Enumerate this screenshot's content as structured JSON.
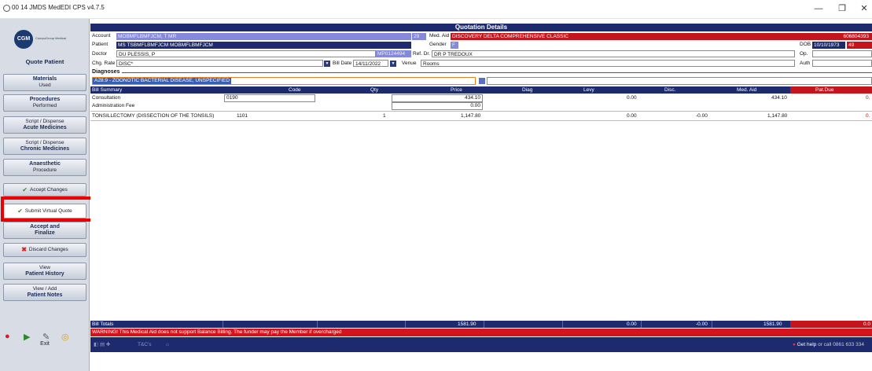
{
  "window": {
    "title": "00 14 JMDS MedEDI CPS v4.7.5",
    "minimize": "—",
    "maximize": "❐",
    "close": "✕"
  },
  "sidebar": {
    "logo": "CGM",
    "logo_sub": "CompuGroup Medical",
    "section_title": "Quote Patient",
    "materials": {
      "line1": "Materials",
      "line2": "Used"
    },
    "procedures": {
      "line1": "Procedures",
      "line2": "Performed"
    },
    "script_acute": {
      "line1": "Script / Dispense",
      "line2": "Acute Medicines"
    },
    "script_chronic": {
      "line1": "Script / Dispense",
      "line2": "Chronic Medicines"
    },
    "anaesthetic": {
      "line1": "Anaesthetic",
      "line2": "Procedure"
    },
    "accept_changes": "Accept Changes",
    "submit_virtual_quote": "Submit Virtual Quote",
    "accept_finalize": {
      "line1": "Accept and",
      "line2": "Finalize"
    },
    "discard_changes": "Discard Changes",
    "view_history": {
      "line1": "View",
      "line2": "Patient History"
    },
    "view_notes": {
      "line1": "View / Add",
      "line2": "Patient Notes"
    },
    "exit": "Exit"
  },
  "header": {
    "title": "Quotation Details"
  },
  "patient": {
    "account_label": "Account",
    "account_value": "MOBMFLBMFJCM, T MR",
    "account_num": "29",
    "med_aid_label": "Med. Aid",
    "med_aid_value": "DISCOVERY DELTA COMPREHENSIVE CLASSIC",
    "med_aid_number": "606804393",
    "patient_label": "Patient",
    "patient_value": "MS TSBMFLBMFJCM MOBMFLBMFJCM",
    "gender_label": "Gender",
    "gender_value": "F",
    "dob_label": "DOB",
    "dob_value": "10/10/1973",
    "age_value": "49",
    "doctor_label": "Doctor",
    "doctor_value": "DU PLESSIS, P",
    "doctor_code": "MP0124494",
    "ref_dr_label": "Ref. Dr.",
    "ref_dr_value": "DR P TREDOUX",
    "op_label": "Op.",
    "chg_rate_label": "Chg. Rate",
    "chg_rate_value": "DISC*",
    "bill_date_label": "Bill Date",
    "bill_date_value": "14/11/2022",
    "venue_label": "Venue",
    "venue_value": "Rooms",
    "auth_label": "Auth"
  },
  "diagnoses": {
    "label": "Diagnoses",
    "value": "A28.9 - ZOONOTIC BACTERIAL DISEASE, UNSPECIFIED"
  },
  "bill": {
    "columns": [
      "Bill Summary",
      "Code",
      "Qty",
      "Price",
      "Diag",
      "Levy",
      "Disc.",
      "Med. Aid",
      "Pat.Due"
    ],
    "rows": [
      {
        "desc": "Consultation",
        "code": "0190",
        "qty": "",
        "price": "434.10",
        "levy": "0.00",
        "disc": "",
        "med_aid": "434.10",
        "pat_due": "0."
      },
      {
        "desc": "Administration Fee",
        "code": "",
        "qty": "",
        "price": "0.00",
        "levy": "",
        "disc": "",
        "med_aid": "",
        "pat_due": ""
      },
      {
        "desc": "TONSILLECTOMY (DISSECTION OF THE TONSILS)",
        "code": "1101",
        "qty": "1",
        "price": "1,147.80",
        "levy": "0.00",
        "disc": "-0.00",
        "med_aid": "1,147.80",
        "pat_due": "0."
      }
    ],
    "totals": {
      "label": "Bill Totals",
      "price": "1581.90",
      "levy": "0.00",
      "disc": "-0.00",
      "med_aid": "1581.90",
      "pat_due": "0.0"
    },
    "warning": "WARNING! This Medical Aid does not support Balance Billing. The funder may pay the Member if overcharged"
  },
  "footer": {
    "links": "T&C's",
    "help_text": "Get help",
    "help_call": "or call 0861 633 334"
  },
  "colors": {
    "navy": "#1e2a6e",
    "red": "#c4141c",
    "highlight": "#e00000"
  }
}
